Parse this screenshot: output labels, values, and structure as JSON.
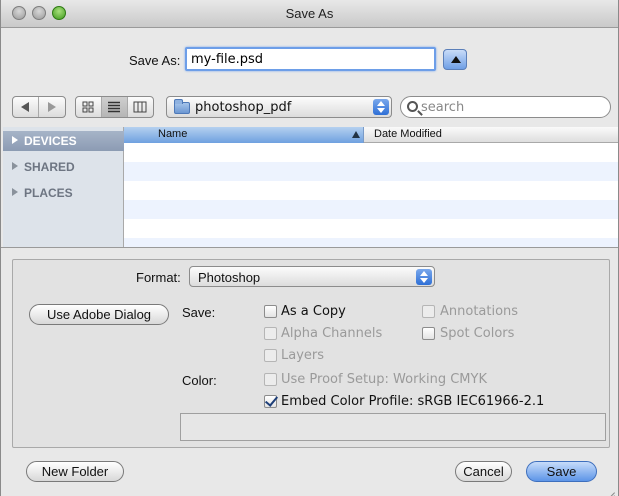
{
  "window": {
    "title": "Save As"
  },
  "saveas": {
    "label": "Save As:",
    "filename": "my-file.psd"
  },
  "toolbar": {
    "folder": "photoshop_pdf",
    "search_placeholder": "search"
  },
  "sidebar": {
    "items": [
      {
        "label": "DEVICES",
        "selected": true
      },
      {
        "label": "SHARED",
        "selected": false
      },
      {
        "label": "PLACES",
        "selected": false
      }
    ]
  },
  "filelist": {
    "columns": [
      "Name",
      "Date Modified"
    ]
  },
  "options": {
    "format_label": "Format:",
    "format_value": "Photoshop",
    "adobe_dialog": "Use Adobe Dialog",
    "save_label": "Save:",
    "color_label": "Color:",
    "checkboxes": {
      "as_a_copy": "As a Copy",
      "annotations": "Annotations",
      "alpha_channels": "Alpha Channels",
      "spot_colors": "Spot Colors",
      "layers": "Layers",
      "proof_setup": "Use Proof Setup:  Working CMYK",
      "embed_profile": "Embed Color Profile:  sRGB IEC61966-2.1"
    }
  },
  "buttons": {
    "new_folder": "New Folder",
    "cancel": "Cancel",
    "save": "Save"
  },
  "colors": {
    "accent": "#5d95e8",
    "selection": "#8c9bb3",
    "row_alt": "#edf3fe"
  }
}
